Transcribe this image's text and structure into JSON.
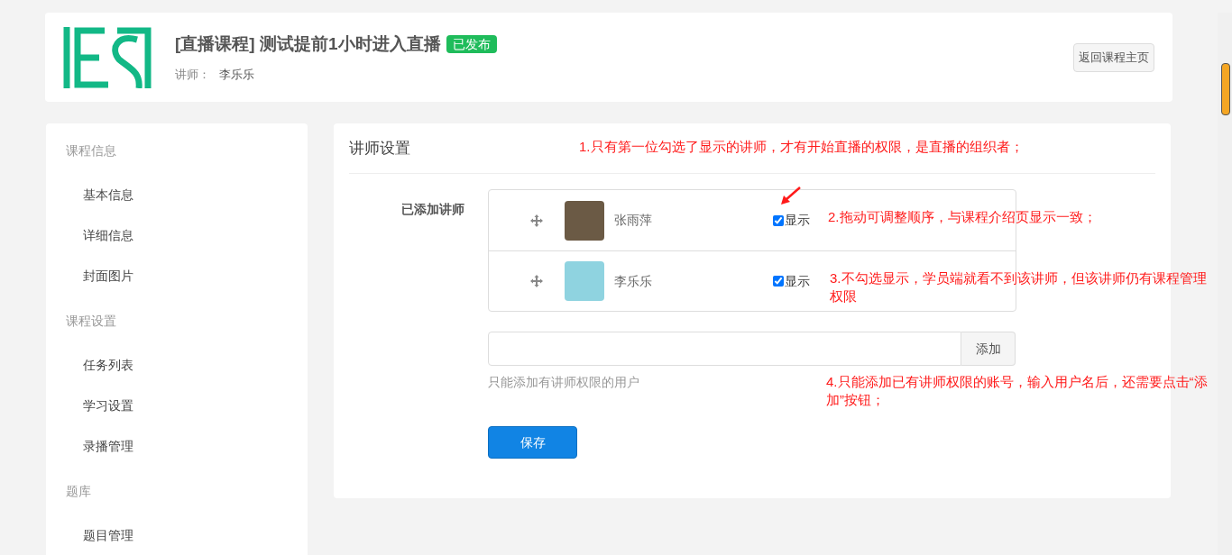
{
  "course": {
    "title": "[直播课程] 测试提前1小时进入直播",
    "status": "已发布",
    "teacher_label": "讲师：",
    "teacher": "李乐乐",
    "back_button": "返回课程主页"
  },
  "sidebar": {
    "groups": [
      {
        "title": "课程信息",
        "items": [
          {
            "label": "基本信息",
            "selected": false
          },
          {
            "label": "详细信息",
            "selected": false
          },
          {
            "label": "封面图片",
            "selected": false
          }
        ]
      },
      {
        "title": "课程设置",
        "items": [
          {
            "label": "任务列表",
            "selected": false
          },
          {
            "label": "学习设置",
            "selected": false
          },
          {
            "label": "录播管理",
            "selected": false
          }
        ]
      },
      {
        "title": "题库",
        "items": [
          {
            "label": "题目管理",
            "selected": false
          }
        ]
      }
    ]
  },
  "panel": {
    "title": "讲师设置",
    "field_label": "已添加讲师",
    "teachers": [
      {
        "name": "张雨萍",
        "show_label": "显示",
        "checked": true
      },
      {
        "name": "李乐乐",
        "show_label": "显示",
        "checked": true
      }
    ],
    "add_button": "添加",
    "help": "只能添加有讲师权限的用户",
    "save_button": "保存",
    "annotations": [
      "1.只有第一位勾选了显示的讲师，才有开始直播的权限，是直播的组织者；",
      "2.拖动可调整顺序，与课程介绍页显示一致；",
      "3.不勾选显示，学员端就看不到该讲师，但该讲师仍有课程管理权限",
      "4.只能添加已有讲师权限的账号，输入用户名后，还需要点击“添加”按钮；"
    ]
  }
}
